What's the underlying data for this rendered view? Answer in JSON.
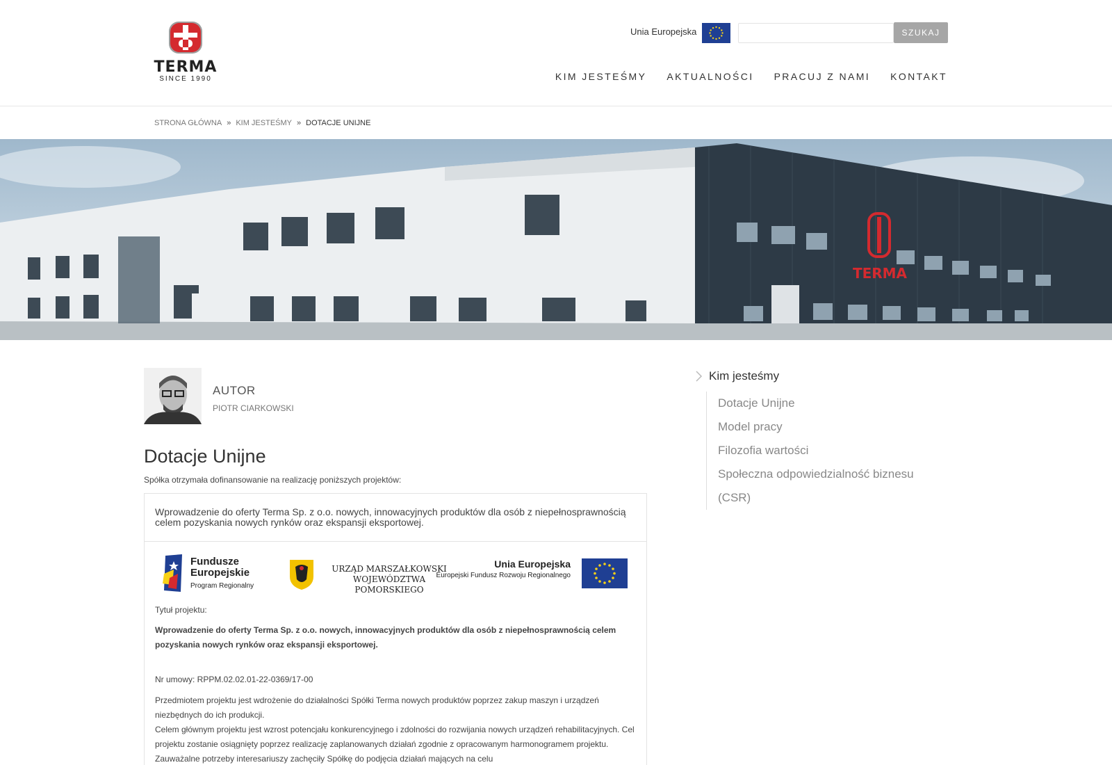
{
  "header": {
    "logo": {
      "wordmark": "TERMA",
      "since": "SINCE 1990"
    },
    "eu_link": "Unia Europejska",
    "search": {
      "placeholder": "",
      "button_label": "SZUKAJ"
    },
    "nav": [
      "KIM JESTEŚMY",
      "AKTUALNOŚCI",
      "PRACUJ Z NAMI",
      "KONTAKT"
    ]
  },
  "breadcrumb": {
    "home": "STRONA GŁÓWNA",
    "parent": "KIM JESTEŚMY",
    "current": "DOTACJE UNIJNE",
    "separator": "»"
  },
  "hero": {
    "building_sign": "TERMA"
  },
  "author": {
    "label": "AUTOR",
    "name": "PIOTR CIARKOWSKI"
  },
  "page": {
    "title": "Dotacje Unijne",
    "intro": "Spółka otrzymała dofinansowanie na realizację poniższych projektów:"
  },
  "project": {
    "heading": "Wprowadzenie do oferty Terma Sp. z o.o. nowych, innowacyjnych produktów dla osób z niepełnosprawnością celem pozyskania nowych rynków oraz ekspansji eksportowej.",
    "logos": {
      "fe_title": "Fundusze Europejskie",
      "fe_sub": "Program Regionalny",
      "um_text": "URZĄD MARSZAŁKOWSKI WOJEWÓDZTWA POMORSKIEGO",
      "ue_title": "Unia Europejska",
      "ue_sub": "Europejski Fundusz Rozwoju Regionalnego"
    },
    "title_label": "Tytuł projektu:",
    "title_value": "Wprowadzenie do oferty Terma Sp. z o.o. nowych, innowacyjnych produktów dla osób z niepełnosprawnością celem pozyskania nowych rynków oraz ekspansji eksportowej.",
    "contract": "Nr umowy: RPPM.02.02.01-22-0369/17-00",
    "para1": "Przedmiotem projektu jest wdrożenie do działalności Spółki Terma nowych produktów poprzez zakup maszyn i urządzeń niezbędnych do ich produkcji.",
    "para2": "Celem głównym projektu jest wzrost potencjału konkurencyjnego i zdolności do rozwijania nowych urządzeń rehabilitacyjnych. Cel projektu zostanie osiągnięty poprzez realizację zaplanowanych działań zgodnie z opracowanym harmonogramem projektu. Zauważalne potrzeby interesariuszy zachęciły Spółkę do podjęcia działań mających na celu"
  },
  "sidebar": {
    "title": "Kim jesteśmy",
    "items": [
      "Dotacje Unijne",
      "Model pracy",
      "Filozofia wartości",
      "Społeczna odpowiedzialność biznesu (CSR)"
    ]
  },
  "colors": {
    "brand_red": "#d42a2f",
    "eu_blue": "#1f3f93",
    "eu_yellow": "#f7d117",
    "button_grey": "#a6a6a6"
  }
}
